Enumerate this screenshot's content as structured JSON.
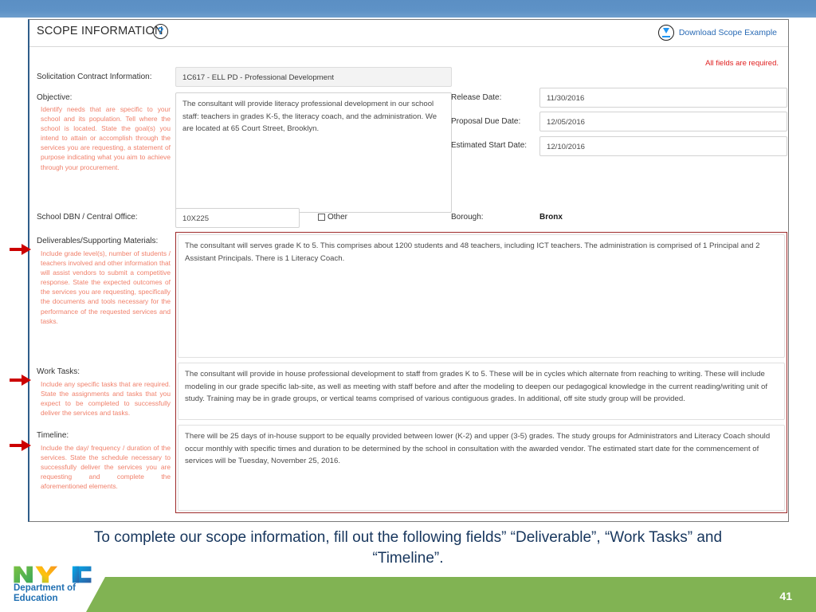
{
  "header": {
    "title": "SCOPE INFORMATION",
    "help_icon_label": "?",
    "download_link": "Download Scope Example",
    "required_note": "All fields are required."
  },
  "form": {
    "solicitation_label": "Solicitation Contract Information:",
    "solicitation_value": "1C617 - ELL PD - Professional Development",
    "objective_label": "Objective:",
    "objective_hint": "Identify needs that are specific to your school and its population. Tell where the school is located. State the goal(s) you intend to attain or accomplish through the services you are requesting, a statement of purpose indicating what you aim to achieve through your procurement.",
    "objective_value": "The consultant will provide literacy professional development in our school staff: teachers in grades K-5, the literacy coach, and the administration. We are located at 65 Court Street, Brooklyn.",
    "release_date_label": "Release Date:",
    "release_date_value": "11/30/2016",
    "proposal_due_label": "Proposal Due Date:",
    "proposal_due_value": "12/05/2016",
    "estimated_start_label": "Estimated Start Date:",
    "estimated_start_value": "12/10/2016",
    "school_dbn_label": "School DBN / Central Office:",
    "school_dbn_value": "10X225",
    "other_checkbox_label": "Other",
    "borough_label": "Borough:",
    "borough_value": "Bronx",
    "deliverables_label": "Deliverables/Supporting Materials:",
    "deliverables_hint": "Include grade level(s), number of students / teachers involved and other information that will assist vendors to submit a competitive response. State the expected outcomes of the services you are requesting, specifically the documents and tools necessary for the performance of the requested services and tasks.",
    "deliverables_value": "The consultant will serves grade K to 5. This comprises about 1200 students and 48 teachers, including ICT teachers. The administration is comprised of 1 Principal and 2 Assistant Principals. There is 1 Literacy Coach.",
    "work_tasks_label": "Work Tasks:",
    "work_tasks_hint": "Include any specific tasks that are required. State the assignments and tasks that you expect to be completed to successfully deliver the services and tasks.",
    "work_tasks_value": "The consultant will provide in house professional development to staff from grades K to 5. These will be in cycles which alternate from reaching to writing. These will include modeling in our grade specific lab-site, as well as meeting with staff before and after the modeling to deepen our pedagogical knowledge in the current reading/writing unit of study. Training may be in grade groups, or vertical teams comprised of various contiguous grades. In additional, off site study group will be provided.",
    "timeline_label": "Timeline:",
    "timeline_hint": "Include the day/ frequency / duration of the services. State the schedule necessary to successfully deliver the services you are requesting and complete the aforementioned elements.",
    "timeline_value": "There will be 25 days of in-house support to be equally provided between lower (K-2) and upper (3-5) grades. The study groups for Administrators and Literacy Coach should occur monthly with specific times and duration to be determined by the school in consultation with the awarded vendor. The estimated start date for the commencement of services will be Tuesday, November 25, 2016."
  },
  "slide": {
    "caption": "To complete our scope information, fill out the following fields” “Deliverable”, “Work Tasks” and “Timeline”.",
    "page_number": "41",
    "logo_primary": "NYC",
    "logo_secondary": "Department of Education"
  },
  "colors": {
    "top_band": "#5e92c6",
    "hint_text": "#f0806b",
    "required_red": "#e02020",
    "emphasis_box": "#9e2b2b",
    "arrow_red": "#cc0000",
    "caption_blue": "#17365d",
    "footer_green": "#81b353",
    "link_blue": "#2a6bb5"
  }
}
